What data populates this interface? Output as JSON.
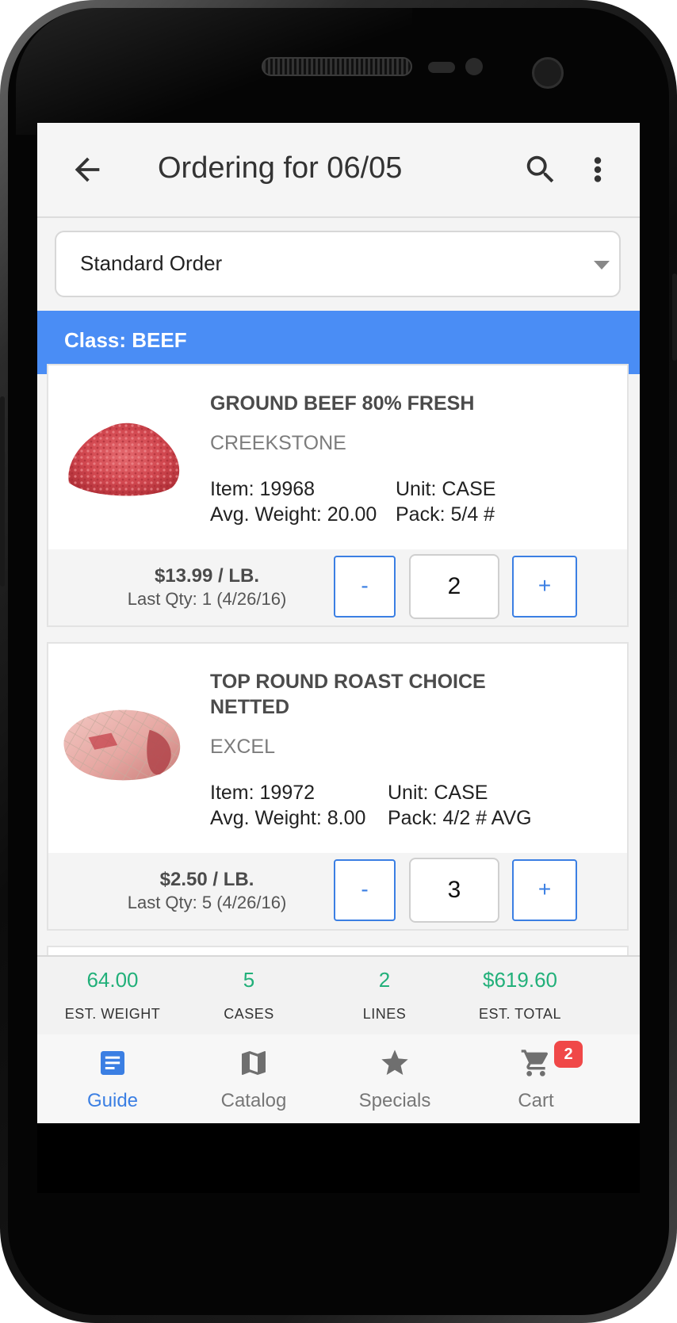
{
  "appbar": {
    "title": "Ordering for 06/05",
    "back_icon": "arrow-left-icon",
    "search_icon": "search-icon",
    "menu_icon": "more-vert-icon"
  },
  "order_select": {
    "value": "Standard Order"
  },
  "class_header": {
    "label": "Class: BEEF"
  },
  "products": [
    {
      "name": "GROUND BEEF 80% FRESH",
      "brand": "CREEKSTONE",
      "item": "Item: 19968",
      "unit": "Unit: CASE",
      "avg_weight": "Avg. Weight: 20.00",
      "pack": "Pack: 5/4 #",
      "price": "$13.99",
      "price_unit": "/ LB.",
      "last_qty": "Last Qty: 1 (4/26/16)",
      "minus": "-",
      "qty": "2",
      "plus": "+"
    },
    {
      "name_line1": "TOP ROUND ROAST CHOICE",
      "name_line2": "NETTED",
      "brand": "EXCEL",
      "item": "Item: 19972",
      "unit": "Unit: CASE",
      "avg_weight": "Avg. Weight: 8.00",
      "pack": "Pack: 4/2 # AVG",
      "price": "$2.50",
      "price_unit": "/ LB.",
      "last_qty": "Last Qty: 5 (4/26/16)",
      "minus": "-",
      "qty": "3",
      "plus": "+"
    }
  ],
  "summary": [
    {
      "value": "64.00",
      "label": "EST. WEIGHT"
    },
    {
      "value": "5",
      "label": "CASES"
    },
    {
      "value": "2",
      "label": "LINES"
    },
    {
      "value": "$619.60",
      "label": "EST. TOTAL"
    }
  ],
  "bottom_nav": [
    {
      "label": "Guide",
      "icon": "list-doc-icon",
      "active": true
    },
    {
      "label": "Catalog",
      "icon": "map-icon",
      "active": false
    },
    {
      "label": "Specials",
      "icon": "star-icon",
      "active": false
    },
    {
      "label": "Cart",
      "icon": "cart-icon",
      "active": false,
      "badge": "2"
    }
  ],
  "colors": {
    "accent": "#3b7fe3",
    "class_bar": "#4a8df5",
    "summary_value": "#22b07a",
    "badge": "#f04848"
  }
}
